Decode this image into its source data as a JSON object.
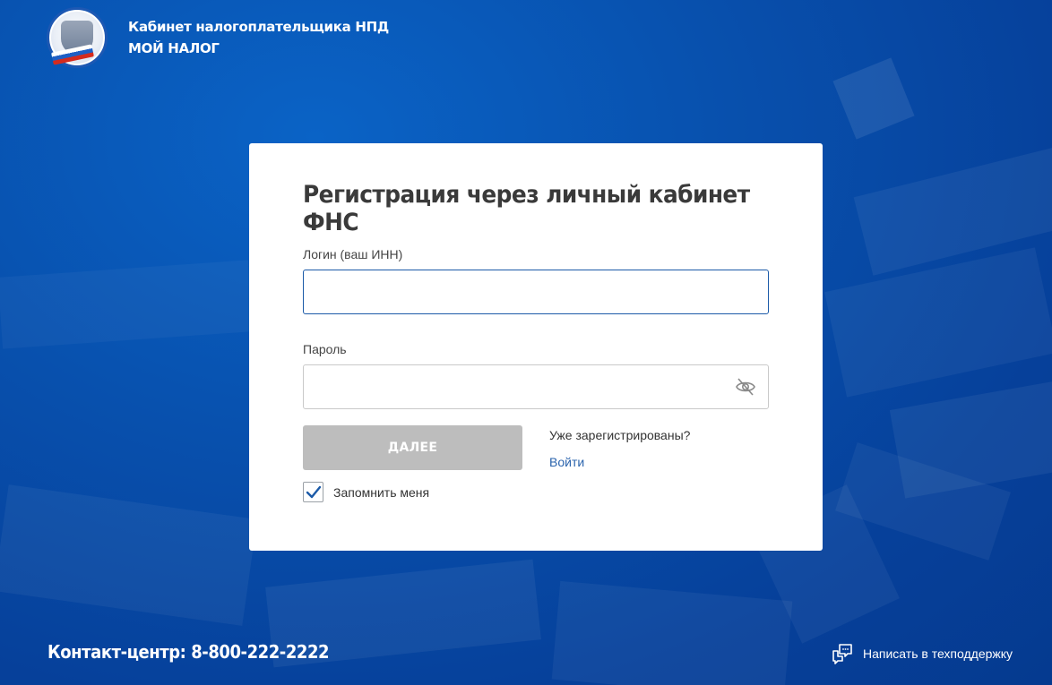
{
  "header": {
    "title_line1": "Кабинет налогоплательщика НПД",
    "title_line2": "МОЙ НАЛОГ",
    "logo_icon": "fns-emblem-icon"
  },
  "form": {
    "title": "Регистрация через личный кабинет ФНС",
    "login_label": "Логин (ваш ИНН)",
    "login_value": "",
    "password_label": "Пароль",
    "password_value": "",
    "password_toggle_icon": "eye-off-icon",
    "submit_label": "ДАЛЕЕ",
    "already_registered": "Уже зарегистрированы?",
    "login_link": "Войти",
    "remember_label": "Запомнить меня",
    "remember_checked": true
  },
  "footer": {
    "contact": "Контакт-центр: 8-800-222-2222",
    "support_label": "Написать в техподдержку",
    "support_icon": "chat-icon"
  },
  "colors": {
    "background": "#0850ad",
    "accent": "#1b5aa8",
    "link": "#2b64ad",
    "button_disabled": "#bdbdbd"
  }
}
